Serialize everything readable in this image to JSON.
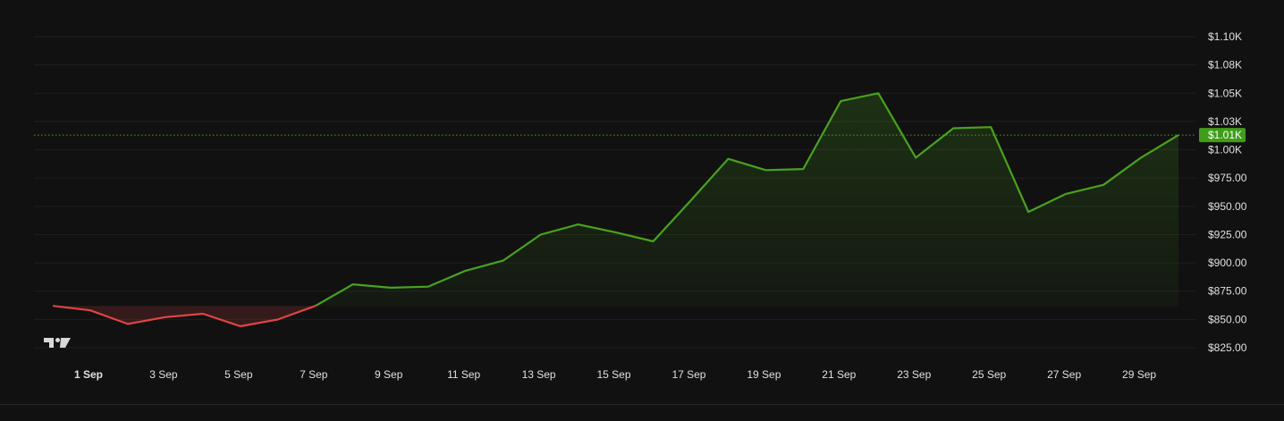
{
  "colors": {
    "background": "#111111",
    "grid": "#1f1f1f",
    "text": "#e0e0e0",
    "up_line": "#49a21e",
    "down_line": "#e04545",
    "price_badge": "#3f9d1a"
  },
  "chart_data": {
    "type": "area",
    "title": "",
    "xlabel": "",
    "ylabel": "",
    "x": [
      "1 Sep",
      "2 Sep",
      "3 Sep",
      "4 Sep",
      "5 Sep",
      "6 Sep",
      "7 Sep",
      "8 Sep",
      "9 Sep",
      "10 Sep",
      "11 Sep",
      "12 Sep",
      "13 Sep",
      "14 Sep",
      "15 Sep",
      "16 Sep",
      "17 Sep",
      "18 Sep",
      "19 Sep",
      "20 Sep",
      "21 Sep",
      "22 Sep",
      "23 Sep",
      "24 Sep",
      "25 Sep",
      "26 Sep",
      "27 Sep",
      "28 Sep",
      "29 Sep",
      "30 Sep"
    ],
    "values": [
      862,
      858,
      846,
      852,
      855,
      844,
      850,
      862,
      881,
      878,
      879,
      893,
      902,
      925,
      934,
      927,
      919,
      955,
      992,
      982,
      983,
      1043,
      1050,
      993,
      1019,
      1020,
      945,
      961,
      969,
      993
    ],
    "last_value": 1013,
    "baseline": 862,
    "ylim": [
      815,
      1108
    ],
    "y_ticks": [
      825,
      850,
      875,
      900,
      925,
      950,
      975,
      1000,
      1025,
      1050,
      1075,
      1100
    ],
    "y_tick_labels": [
      "$825.00",
      "$850.00",
      "$875.00",
      "$900.00",
      "$925.00",
      "$950.00",
      "$975.00",
      "$1.00K",
      "$1.03K",
      "$1.05K",
      "$1.08K",
      "$1.10K"
    ],
    "x_ticks": [
      "1 Sep",
      "3 Sep",
      "5 Sep",
      "7 Sep",
      "9 Sep",
      "11 Sep",
      "13 Sep",
      "15 Sep",
      "17 Sep",
      "19 Sep",
      "21 Sep",
      "23 Sep",
      "25 Sep",
      "27 Sep",
      "29 Sep"
    ],
    "current_price_label": "$1.01K",
    "grid": true,
    "logo": "tradingview-logo-icon"
  }
}
